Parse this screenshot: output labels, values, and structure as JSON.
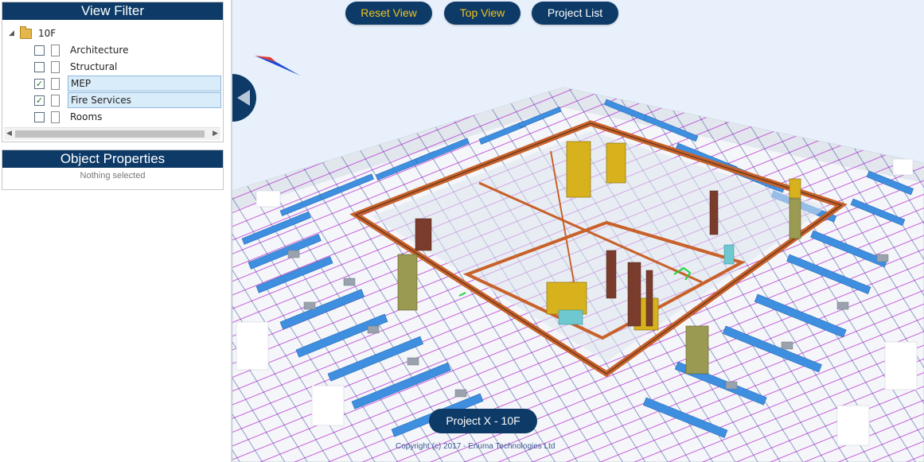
{
  "view_filter": {
    "title": "View Filter",
    "root_label": "10F",
    "items": [
      {
        "label": "Architecture",
        "checked": false,
        "selected": false
      },
      {
        "label": "Structural",
        "checked": false,
        "selected": false
      },
      {
        "label": "MEP",
        "checked": true,
        "selected": true
      },
      {
        "label": "Fire Services",
        "checked": true,
        "selected": true
      },
      {
        "label": "Rooms",
        "checked": false,
        "selected": false
      }
    ]
  },
  "object_properties": {
    "title": "Object Properties",
    "empty_text": "Nothing selected"
  },
  "toolbar": {
    "reset_view": "Reset View",
    "top_view": "Top View",
    "project_list": "Project List"
  },
  "viewport": {
    "project_label": "Project X - 10F",
    "copyright": "Copyright (c) 2017 - Enuma Technologies Ltd"
  },
  "colors": {
    "navy": "#0d3a67",
    "accent_yellow": "#f2c418",
    "duct_blue": "#3f8fe0",
    "pipe_purple": "#b51fd0",
    "pipe_orange": "#c8612a",
    "background": "#e7f0fb"
  },
  "icons": {
    "tree_root": "folder-icon",
    "tree_item": "document-icon",
    "collapse": "triangle-left-icon",
    "compass": "compass-arrow-icon"
  }
}
